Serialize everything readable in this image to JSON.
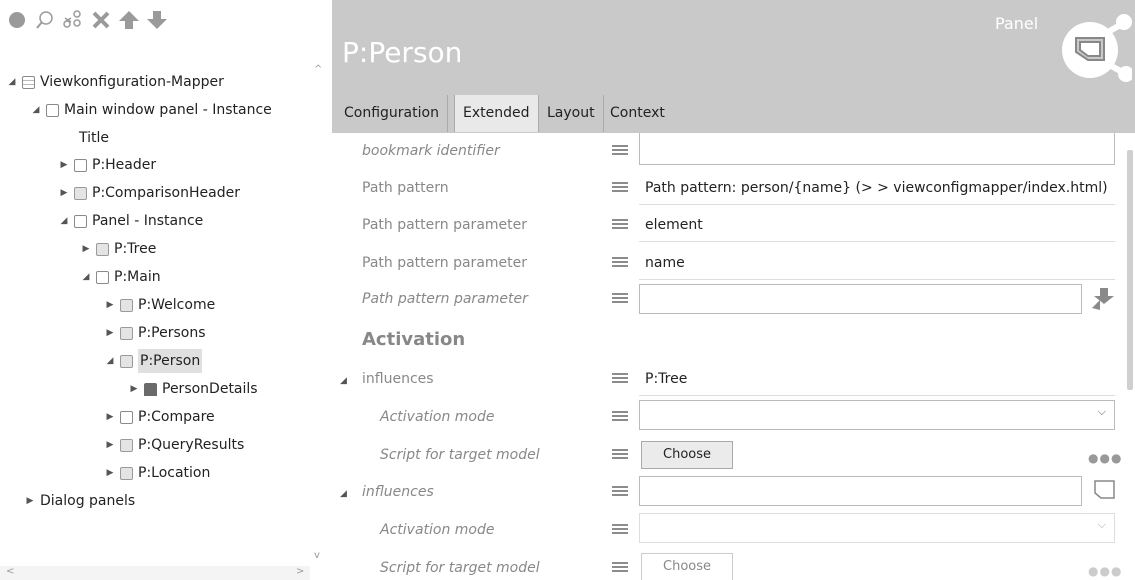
{
  "toolbar": {
    "icons": [
      "record-icon",
      "search-icon",
      "link-nodes-icon",
      "delete-icon",
      "move-up-icon",
      "move-down-icon"
    ]
  },
  "tree": {
    "root": "Viewkonfiguration-Mapper",
    "main_window": "Main window panel - Instance",
    "title": "Title",
    "header": "P:Header",
    "comparison_header": "P:ComparisonHeader",
    "panel_instance": "Panel - Instance",
    "tree": "P:Tree",
    "main": "P:Main",
    "welcome": "P:Welcome",
    "persons": "P:Persons",
    "person": "P:Person",
    "person_details": "PersonDetails",
    "compare": "P:Compare",
    "query_results": "P:QueryResults",
    "location": "P:Location",
    "dialog_panels": "Dialog panels"
  },
  "header": {
    "title": "P:Person",
    "type": "Panel"
  },
  "tabs": [
    "Configuration",
    "Extended",
    "Layout",
    "Context"
  ],
  "active_tab": "Extended",
  "form": {
    "bookmark_label": "bookmark identifier",
    "bookmark_value": "",
    "path_pattern_label": "Path pattern",
    "path_pattern_value": "Path pattern: person/{name} (> > viewconfigmapper/index.html)",
    "param1_label": "Path pattern parameter",
    "param1_value": "element",
    "param2_label": "Path pattern parameter",
    "param2_value": "name",
    "param3_label": "Path pattern parameter",
    "param3_value": "",
    "activation_section": "Activation",
    "influences1_label": "influences",
    "influences1_value": "P:Tree",
    "mode1_label": "Activation mode",
    "mode1_value": "",
    "script1_label": "Script for target model",
    "script1_button": "Choose",
    "influences2_label": "influences",
    "influences2_value": "",
    "mode2_label": "Activation mode",
    "mode2_value": "",
    "script2_label": "Script for target model",
    "script2_button": "Choose"
  },
  "colors": {
    "header_bg": "#c9c9c9",
    "active_tab_bg": "#e9e9e9",
    "label_gray": "#888888"
  }
}
